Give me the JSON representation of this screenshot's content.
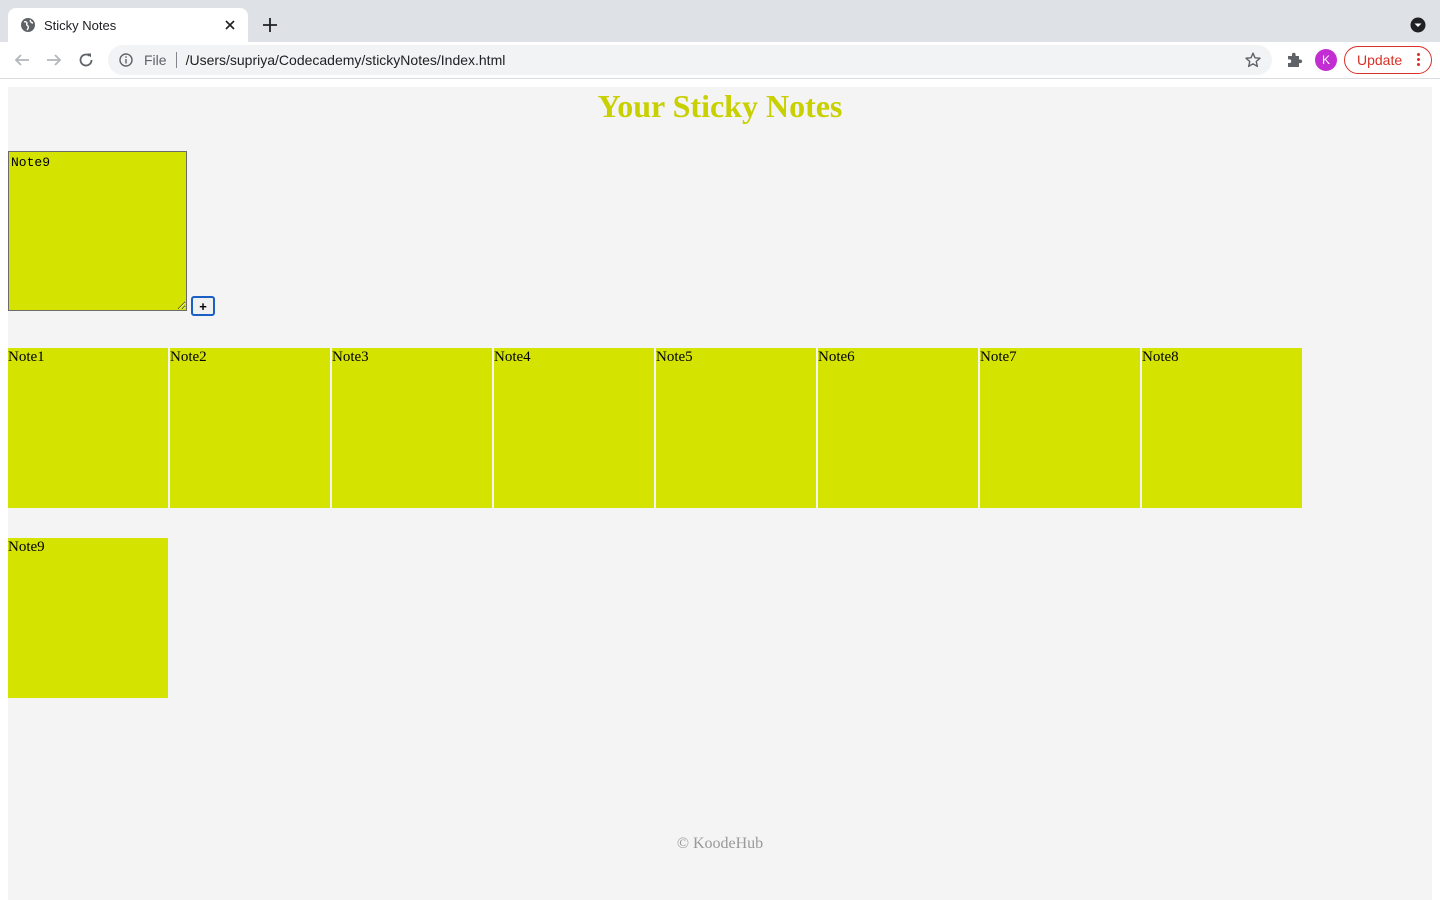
{
  "browser": {
    "tab_title": "Sticky Notes",
    "scheme_label": "File",
    "url": "/Users/supriya/Codecademy/stickyNotes/Index.html",
    "profile_initial": "K",
    "update_label": "Update",
    "profile_color": "#c22ed1",
    "update_color": "#d93025"
  },
  "page": {
    "title": "Your Sticky Notes",
    "input_value": "Note9",
    "add_button_label": "+",
    "notes": [
      "Note1",
      "Note2",
      "Note3",
      "Note4",
      "Note5",
      "Note6",
      "Note7",
      "Note8",
      "Note9"
    ],
    "footer": "© KoodeHub",
    "note_color": "#d4e300",
    "title_color": "#c8d000",
    "background_color": "#f4f4f4"
  }
}
